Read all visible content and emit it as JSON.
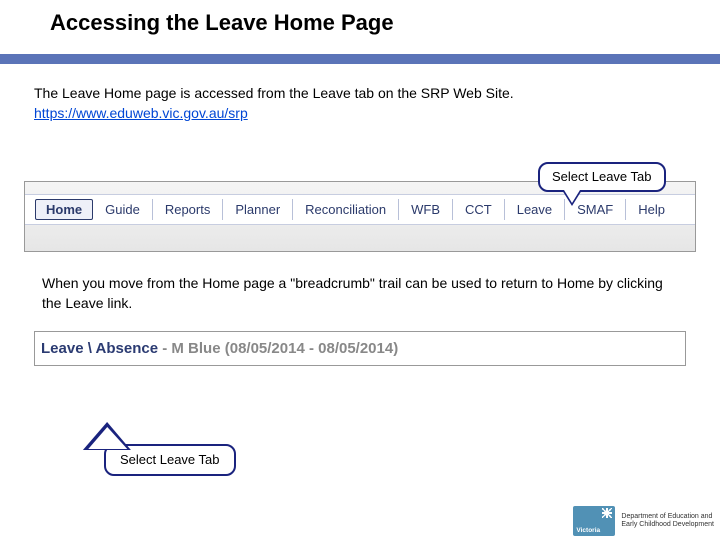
{
  "title": "Accessing the Leave Home Page",
  "intro": {
    "text": "The Leave Home page is accessed from the Leave tab on the SRP Web Site.",
    "url": "https://www.eduweb.vic.gov.au/srp"
  },
  "callouts": {
    "top": "Select Leave Tab",
    "bottom": "Select Leave Tab"
  },
  "tabs": [
    "Home",
    "Guide",
    "Reports",
    "Planner",
    "Reconciliation",
    "WFB",
    "CCT",
    "Leave",
    "SMAF",
    "Help"
  ],
  "para2": "When you move from the Home page a \"breadcrumb\" trail can be used to return to Home by clicking the Leave link.",
  "breadcrumb": {
    "leave": "Leave",
    "sep": "\\",
    "absence": "Absence",
    "dash": "-",
    "name": "M Blue",
    "dates": "(08/05/2014 - 08/05/2014)"
  },
  "footer": {
    "state": "Victoria",
    "dept1": "Department of Education and",
    "dept2": "Early Childhood Development"
  }
}
